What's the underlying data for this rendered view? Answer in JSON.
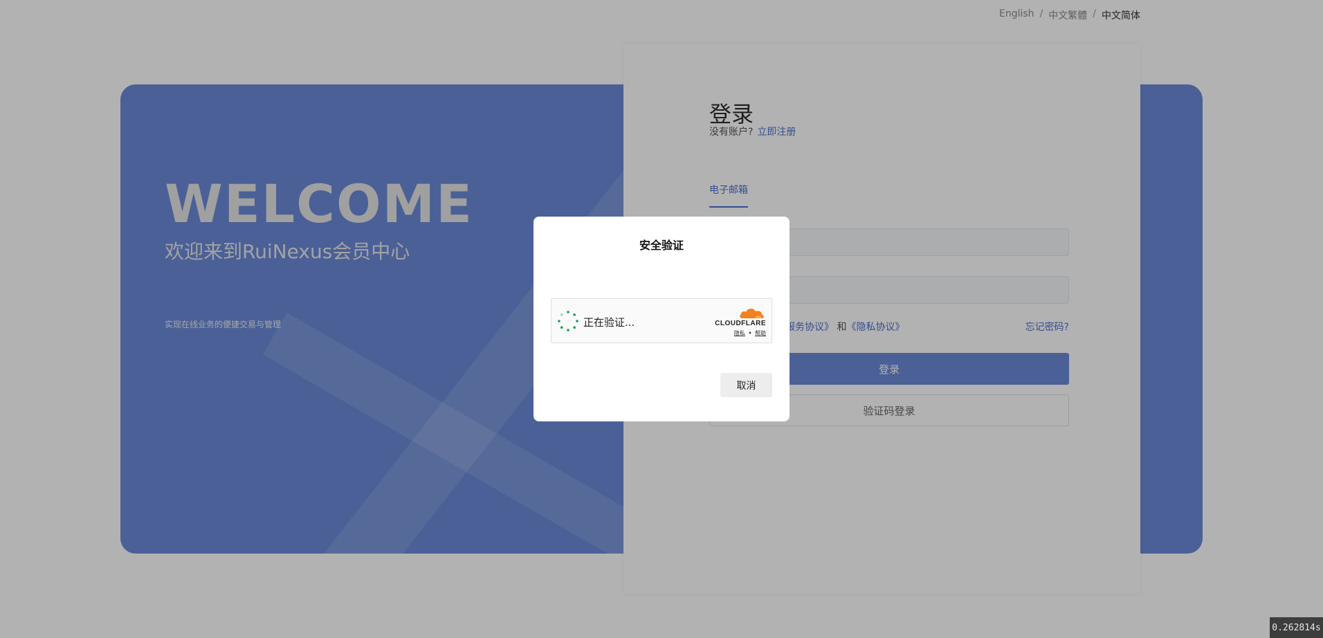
{
  "language_switcher": {
    "items": [
      "English",
      "中文繁體",
      "中文简体"
    ],
    "separator": "/",
    "active": "中文简体"
  },
  "hero": {
    "welcome": "WELCOME",
    "subtitle": "欢迎来到RuiNexus会员中心",
    "tagline": "实现在线业务的便捷交易与管理"
  },
  "login": {
    "title": "登录",
    "no_account": "没有账户?",
    "register_link": "立即注册",
    "tab_email": "电子邮箱",
    "agreement_service": "服务协议》",
    "agreement_and": " 和",
    "agreement_privacy": "《隐私协议》",
    "forgot_password": "忘记密码?",
    "login_button": "登录",
    "code_login_button": "验证码登录"
  },
  "dialog": {
    "title": "安全验证",
    "turnstile_status": "正在验证...",
    "cloudflare_brand": "CLOUDFLARE",
    "privacy_link": "隐私",
    "link_separator": "•",
    "help_link": "帮助",
    "cancel_button": "取消"
  },
  "timer": "0.262814s",
  "colors": {
    "brand_blue": "#6a8ad8",
    "link_blue": "#4a6fd0",
    "cloudflare_orange": "#f48120",
    "spinner_green": "#1a9e4b"
  }
}
